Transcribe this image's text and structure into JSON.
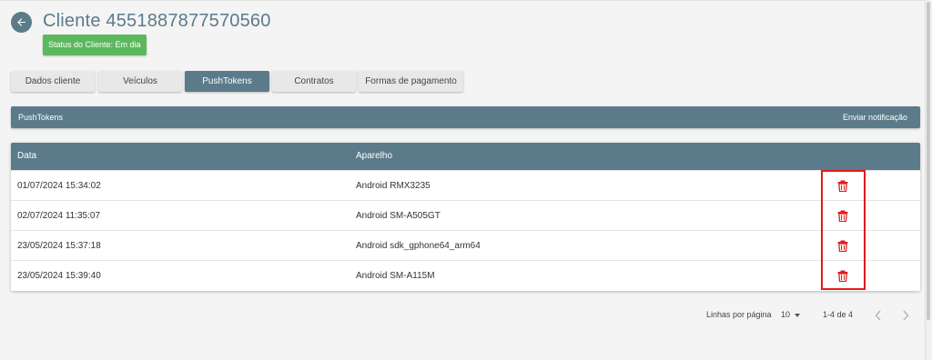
{
  "header": {
    "title": "Cliente 4551887877570560",
    "status": "Status do Cliente: Em dia"
  },
  "tabs": [
    {
      "label": "Dados cliente",
      "active": false
    },
    {
      "label": "Veículos",
      "active": false
    },
    {
      "label": "PushTokens",
      "active": true
    },
    {
      "label": "Contratos",
      "active": false
    },
    {
      "label": "Formas de pagamento",
      "active": false
    }
  ],
  "section": {
    "title": "PushTokens",
    "action": "Enviar notificação"
  },
  "table": {
    "columns": [
      "Data",
      "Aparelho"
    ],
    "rows": [
      {
        "data": "01/07/2024 15:34:02",
        "aparelho": "Android RMX3235"
      },
      {
        "data": "02/07/2024 11:35:07",
        "aparelho": "Android SM-A505GT"
      },
      {
        "data": "23/05/2024 15:37:18",
        "aparelho": "Android sdk_gphone64_arm64"
      },
      {
        "data": "23/05/2024 15:39:40",
        "aparelho": "Android SM-A115M"
      }
    ]
  },
  "pagination": {
    "rows_per_page_label": "Linhas por página",
    "rows_per_page": "10",
    "range": "1-4 de 4"
  },
  "colors": {
    "primary": "#5b7b8a",
    "status_badge": "#5cb85c",
    "delete": "#e21b1b"
  }
}
